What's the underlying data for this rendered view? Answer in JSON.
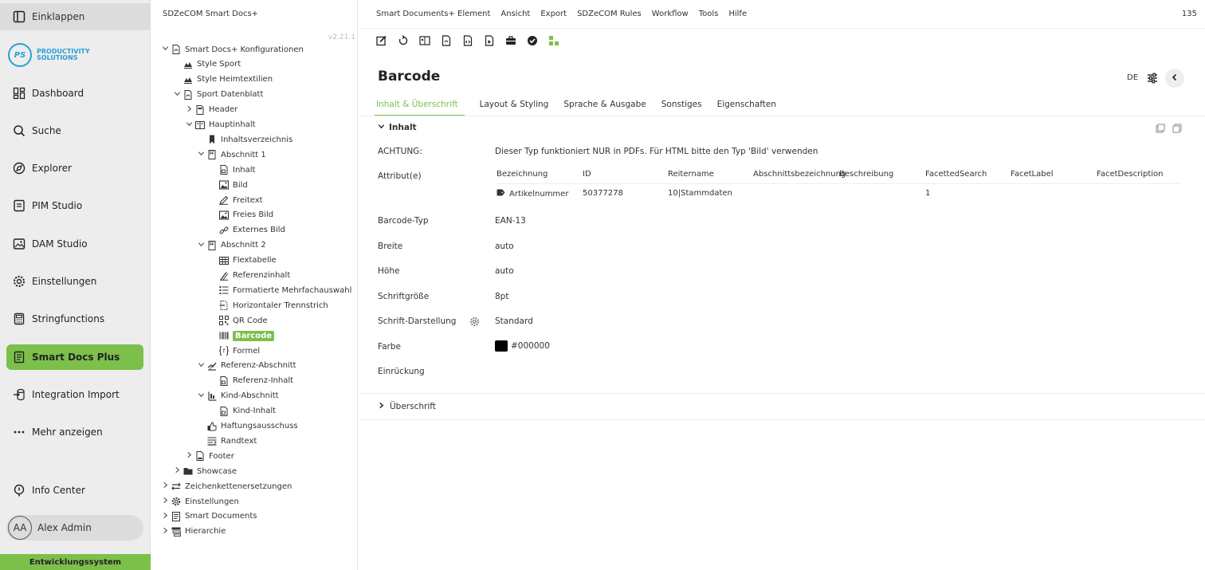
{
  "nav": {
    "collapse_label": "Einklappen",
    "logo_mark": "PS",
    "logo_line1": "PRODUCTIVITY",
    "logo_line2": "SOLUTIONS",
    "items": [
      {
        "label": "Dashboard",
        "icon": "dashboard-icon"
      },
      {
        "label": "Suche",
        "icon": "search-icon"
      },
      {
        "label": "Explorer",
        "icon": "explorer-icon"
      },
      {
        "label": "PIM Studio",
        "icon": "pim-icon"
      },
      {
        "label": "DAM Studio",
        "icon": "image-icon"
      },
      {
        "label": "Einstellungen",
        "icon": "gear-icon"
      },
      {
        "label": "Stringfunctions",
        "icon": "calculator-icon"
      },
      {
        "label": "Smart Docs Plus",
        "icon": "document-icon"
      },
      {
        "label": "Integration Import",
        "icon": "import-icon"
      },
      {
        "label": "Mehr anzeigen",
        "icon": "more-icon"
      }
    ],
    "info_center": "Info Center",
    "user_initials": "AA",
    "user_name": "Alex Admin",
    "environment": "Entwicklungssystem",
    "active_color": "#7cc04b"
  },
  "tree": {
    "title": "SDZeCOM Smart Docs+",
    "version": "v2.21.1",
    "nodes": [
      {
        "label": "Smart Docs+ Konfigurationen",
        "chev": "open",
        "icon": "pdf-icon"
      },
      {
        "label": "Style Sport",
        "chev": "",
        "icon": "style-icon"
      },
      {
        "label": "Style Heimtextilien",
        "chev": "",
        "icon": "style-icon"
      },
      {
        "label": "Sport Datenblatt",
        "chev": "open",
        "icon": "pdf-icon"
      },
      {
        "label": "Header",
        "chev": "closed",
        "icon": "header-icon"
      },
      {
        "label": "Hauptinhalt",
        "chev": "open",
        "icon": "book-icon"
      },
      {
        "label": "Inhaltsverzeichnis",
        "chev": "",
        "icon": "bookmark-icon"
      },
      {
        "label": "Abschnitt 1",
        "chev": "open",
        "icon": "section-icon"
      },
      {
        "label": "Inhalt",
        "chev": "",
        "icon": "content-icon"
      },
      {
        "label": "Bild",
        "chev": "",
        "icon": "image-icon"
      },
      {
        "label": "Freitext",
        "chev": "",
        "icon": "pen-icon"
      },
      {
        "label": "Freies Bild",
        "chev": "",
        "icon": "image-icon"
      },
      {
        "label": "Externes Bild",
        "chev": "",
        "icon": "link-icon"
      },
      {
        "label": "Abschnitt 2",
        "chev": "open",
        "icon": "section-icon"
      },
      {
        "label": "Flextabelle",
        "chev": "",
        "icon": "table-icon"
      },
      {
        "label": "Referenzinhalt",
        "chev": "",
        "icon": "reference-icon"
      },
      {
        "label": "Formatierte Mehrfachauswahl",
        "chev": "",
        "icon": "list-icon"
      },
      {
        "label": "Horizontaler Trennstrich",
        "chev": "",
        "icon": "divider-icon"
      },
      {
        "label": "QR Code",
        "chev": "",
        "icon": "qr-icon"
      },
      {
        "label": "Barcode",
        "chev": "",
        "icon": "barcode-icon",
        "selected": true
      },
      {
        "label": "Formel",
        "chev": "",
        "icon": "formula-icon"
      },
      {
        "label": "Referenz-Abschnitt",
        "chev": "open",
        "icon": "ref-section-icon"
      },
      {
        "label": "Referenz-Inhalt",
        "chev": "",
        "icon": "content-icon"
      },
      {
        "label": "Kind-Abschnitt",
        "chev": "open",
        "icon": "child-section-icon"
      },
      {
        "label": "Kind-Inhalt",
        "chev": "",
        "icon": "content-icon"
      },
      {
        "label": "Haftungsausschuss",
        "chev": "",
        "icon": "disclaimer-icon"
      },
      {
        "label": "Randtext",
        "chev": "",
        "icon": "margin-text-icon"
      },
      {
        "label": "Footer",
        "chev": "closed",
        "icon": "footer-icon"
      },
      {
        "label": "Showcase",
        "chev": "closed",
        "icon": "folder-icon"
      },
      {
        "label": "Zeichenkettenersetzungen",
        "chev": "closed",
        "icon": "swap-icon"
      },
      {
        "label": "Einstellungen",
        "chev": "closed",
        "icon": "gear-icon"
      },
      {
        "label": "Smart Documents",
        "chev": "closed",
        "icon": "document-icon"
      },
      {
        "label": "Hierarchie",
        "chev": "closed",
        "icon": "hierarchy-icon"
      }
    ]
  },
  "menubar": {
    "items": [
      "Smart Documents+ Element",
      "Ansicht",
      "Export",
      "SDZeCOM Rules",
      "Workflow",
      "Tools",
      "Hilfe"
    ],
    "count": "135"
  },
  "editor": {
    "title": "Barcode",
    "language": "DE",
    "tabs": [
      "Inhalt & Überschrift",
      "Layout & Styling",
      "Sprache & Ausgabe",
      "Sonstiges",
      "Eigenschaften"
    ],
    "section_inhalt": "Inhalt",
    "section_ueberschrift": "Überschrift",
    "achtung_label": "ACHTUNG:",
    "achtung_text": "Dieser Typ funktioniert NUR in PDFs. Für HTML bitte den Typ 'Bild' verwenden",
    "attribut_label": "Attribut(e)",
    "attr_table": {
      "headers": [
        "Bezeichnung",
        "ID",
        "Reitername",
        "Abschnittsbezeichnung",
        "Beschreibung",
        "FacettedSearch",
        "FacetLabel",
        "FacetDescription"
      ],
      "row": {
        "bezeichnung": "Artikelnummer",
        "id": "50377278",
        "reitername": "10|Stammdaten",
        "facetted": "1"
      }
    },
    "fields": {
      "barcode_typ_label": "Barcode-Typ",
      "barcode_typ": "EAN-13",
      "breite_label": "Breite",
      "breite": "auto",
      "hoehe_label": "Höhe",
      "hoehe": "auto",
      "schriftgroesse_label": "Schriftgröße",
      "schriftgroesse": "8pt",
      "schrift_darstellung_label": "Schrift-Darstellung",
      "schrift_darstellung": "Standard",
      "farbe_label": "Farbe",
      "farbe": "#000000",
      "einrueckung_label": "Einrückung"
    }
  }
}
